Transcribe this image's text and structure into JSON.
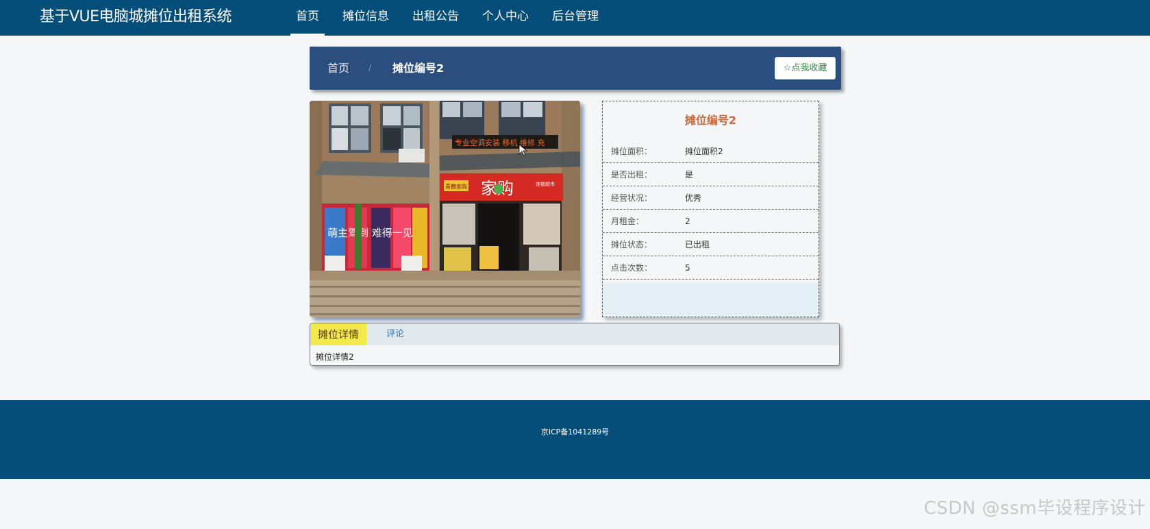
{
  "site": {
    "title": "基于VUE电脑城摊位出租系统"
  },
  "nav": {
    "items": [
      "首页",
      "摊位信息",
      "出租公告",
      "个人中心",
      "后台管理"
    ],
    "active_index": 0
  },
  "breadcrumb": {
    "home": "首页",
    "separator": "/",
    "current": "摊位编号2"
  },
  "favorite_button": "☆点我收藏",
  "image": {
    "storefront_sign": "家购",
    "led_banner": "专业空调安装 移机 维修 充",
    "sub_sign": "青籍家购",
    "side_sign": "连锁超市",
    "poster_text": "萌主驾到 难得一见"
  },
  "info": {
    "title": "摊位编号2",
    "rows": [
      {
        "label": "摊位面积：",
        "value": "摊位面积2"
      },
      {
        "label": "是否出租：",
        "value": "是"
      },
      {
        "label": "经营状况：",
        "value": "优秀"
      },
      {
        "label": "月租金：",
        "value": "2"
      },
      {
        "label": "摊位状态：",
        "value": "已出租"
      },
      {
        "label": "点击次数：",
        "value": "5"
      }
    ]
  },
  "tabs": {
    "items": [
      "摊位详情",
      "评论"
    ],
    "active_index": 0,
    "content": "摊位详情2"
  },
  "footer": {
    "icp": "京ICP备1041289号"
  },
  "watermark": "CSDN @ssm毕设程序设计",
  "colors": {
    "nav_bg": "#054e7a",
    "breadcrumb_bg": "#2c4e7f",
    "info_title": "#c86a3e",
    "active_tab": "#f2e94a",
    "fav_text": "#2e8b3a"
  }
}
